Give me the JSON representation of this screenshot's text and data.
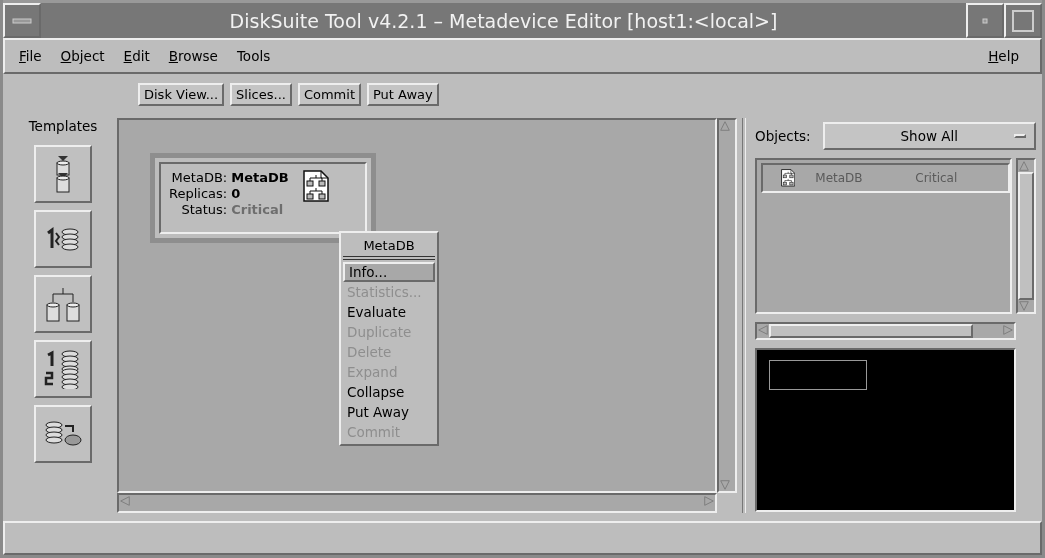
{
  "window": {
    "title": "DiskSuite Tool v4.2.1 – Metadevice Editor [host1:<local>]"
  },
  "menu": [
    {
      "label": "File",
      "mnemonic": true
    },
    {
      "label": "Object",
      "mnemonic": true
    },
    {
      "label": "Edit",
      "mnemonic": true
    },
    {
      "label": "Browse",
      "mnemonic": true
    },
    {
      "label": "Tools",
      "mnemonic": false
    }
  ],
  "help_menu": {
    "label": "Help",
    "mnemonic": true
  },
  "toolbar": [
    "Disk View...",
    "Slices...",
    "Commit",
    "Put Away"
  ],
  "templates": {
    "label": "Templates",
    "items": [
      {
        "kind": "stack"
      },
      {
        "kind": "numbered"
      },
      {
        "kind": "split"
      },
      {
        "kind": "numbered-pair"
      },
      {
        "kind": "transfer"
      }
    ]
  },
  "node": {
    "fields": [
      {
        "label": "MetaDB:",
        "value": "MetaDB",
        "kind": "bold"
      },
      {
        "label": "Replicas:",
        "value": "0",
        "kind": "bold"
      },
      {
        "label": "Status:",
        "value": "Critical",
        "kind": "dim"
      }
    ]
  },
  "context_menu": {
    "title": "MetaDB",
    "items": [
      {
        "label": "Info...",
        "selected": true,
        "disabled": false
      },
      {
        "label": "Statistics...",
        "selected": false,
        "disabled": true
      },
      {
        "label": "Evaluate",
        "selected": false,
        "disabled": false
      },
      {
        "label": "Duplicate",
        "selected": false,
        "disabled": true
      },
      {
        "label": "Delete",
        "selected": false,
        "disabled": true
      },
      {
        "label": "Expand",
        "selected": false,
        "disabled": true
      },
      {
        "label": "Collapse",
        "selected": false,
        "disabled": false
      },
      {
        "label": "Put Away",
        "selected": false,
        "disabled": false
      },
      {
        "label": "Commit",
        "selected": false,
        "disabled": true
      }
    ]
  },
  "objects": {
    "label": "Objects:",
    "filter": "Show All",
    "rows": [
      {
        "name": "MetaDB",
        "status": "Critical",
        "selected": true,
        "disabled": true
      }
    ]
  }
}
